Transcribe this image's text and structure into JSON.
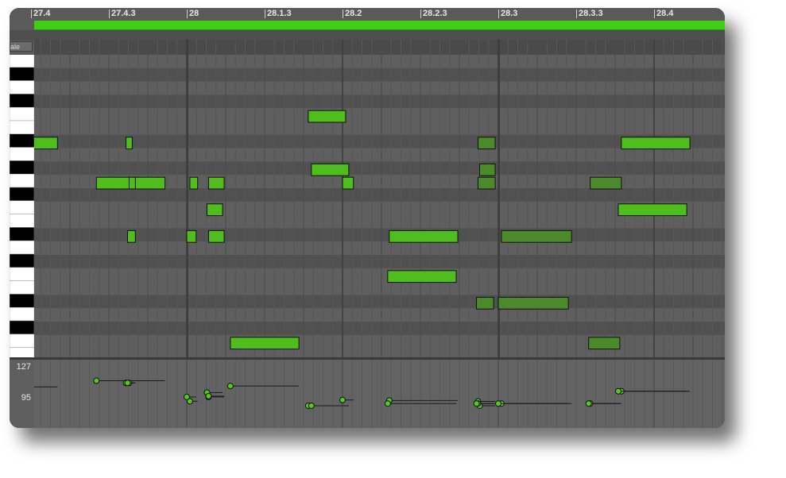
{
  "ruler": {
    "ticks": [
      {
        "label": "27.4",
        "beat": 0
      },
      {
        "label": "27.4.3",
        "beat": 0.5
      },
      {
        "label": "28",
        "beat": 1
      },
      {
        "label": "28.1.3",
        "beat": 1.5
      },
      {
        "label": "28.2",
        "beat": 2
      },
      {
        "label": "28.2.3",
        "beat": 2.5
      },
      {
        "label": "28.3",
        "beat": 3
      },
      {
        "label": "28.3.3",
        "beat": 3.5
      },
      {
        "label": "28.4",
        "beat": 4
      }
    ]
  },
  "scale_button": {
    "label": "ale"
  },
  "velocity_axis": {
    "top_label": "127",
    "mid_label": "95"
  },
  "colors": {
    "note_bright": "#4fbd1c",
    "note_dim": "#4a8a2a",
    "loop_bar": "#3fcf16",
    "grid_bg": "#555555"
  },
  "notes": [
    {
      "row": 6,
      "start": -0.2,
      "dur": 0.37,
      "vel": 83,
      "dim": false
    },
    {
      "row": 6,
      "start": 0.61,
      "dur": 0.04,
      "vel": 92,
      "dim": false
    },
    {
      "row": 6,
      "start": 2.87,
      "dur": 0.11,
      "vel": 50,
      "dim": true
    },
    {
      "row": 6,
      "start": 3.79,
      "dur": 0.44,
      "vel": 73,
      "dim": false
    },
    {
      "row": 4,
      "start": 1.78,
      "dur": 0.24,
      "vel": 40,
      "dim": false
    },
    {
      "row": 8,
      "start": 1.8,
      "dur": 0.24,
      "vel": 40,
      "dim": false
    },
    {
      "row": 8,
      "start": 2.88,
      "dur": 0.1,
      "vel": 40,
      "dim": true
    },
    {
      "row": 9,
      "start": 0.42,
      "dur": 0.44,
      "vel": 97,
      "dim": false
    },
    {
      "row": 9,
      "start": 0.63,
      "dur": 0.04,
      "vel": 92,
      "dim": false
    },
    {
      "row": 9,
      "start": 1.02,
      "dur": 0.05,
      "vel": 50,
      "dim": false
    },
    {
      "row": 9,
      "start": 1.14,
      "dur": 0.1,
      "vel": 60,
      "dim": false
    },
    {
      "row": 9,
      "start": 2.0,
      "dur": 0.07,
      "vel": 53,
      "dim": false
    },
    {
      "row": 9,
      "start": 2.87,
      "dur": 0.11,
      "vel": 45,
      "dim": true
    },
    {
      "row": 9,
      "start": 3.59,
      "dur": 0.2,
      "vel": 45,
      "dim": true
    },
    {
      "row": 11,
      "start": 1.13,
      "dur": 0.1,
      "vel": 70,
      "dim": false
    },
    {
      "row": 11,
      "start": 3.77,
      "dur": 0.44,
      "vel": 73,
      "dim": false
    },
    {
      "row": 13,
      "start": 0.62,
      "dur": 0.05,
      "vel": 92,
      "dim": false
    },
    {
      "row": 13,
      "start": 1.0,
      "dur": 0.06,
      "vel": 60,
      "dim": false
    },
    {
      "row": 13,
      "start": 1.14,
      "dur": 0.1,
      "vel": 62,
      "dim": false
    },
    {
      "row": 13,
      "start": 2.3,
      "dur": 0.44,
      "vel": 52,
      "dim": false
    },
    {
      "row": 13,
      "start": 3.02,
      "dur": 0.45,
      "vel": 45,
      "dim": true
    },
    {
      "row": 16,
      "start": 2.29,
      "dur": 0.44,
      "vel": 45,
      "dim": false
    },
    {
      "row": 18,
      "start": 2.86,
      "dur": 0.11,
      "vel": 45,
      "dim": true
    },
    {
      "row": 18,
      "start": 3.0,
      "dur": 0.45,
      "vel": 45,
      "dim": true
    },
    {
      "row": 21,
      "start": 1.28,
      "dur": 0.44,
      "vel": 85,
      "dim": false
    },
    {
      "row": 21,
      "start": 3.58,
      "dur": 0.2,
      "vel": 45,
      "dim": true
    }
  ]
}
